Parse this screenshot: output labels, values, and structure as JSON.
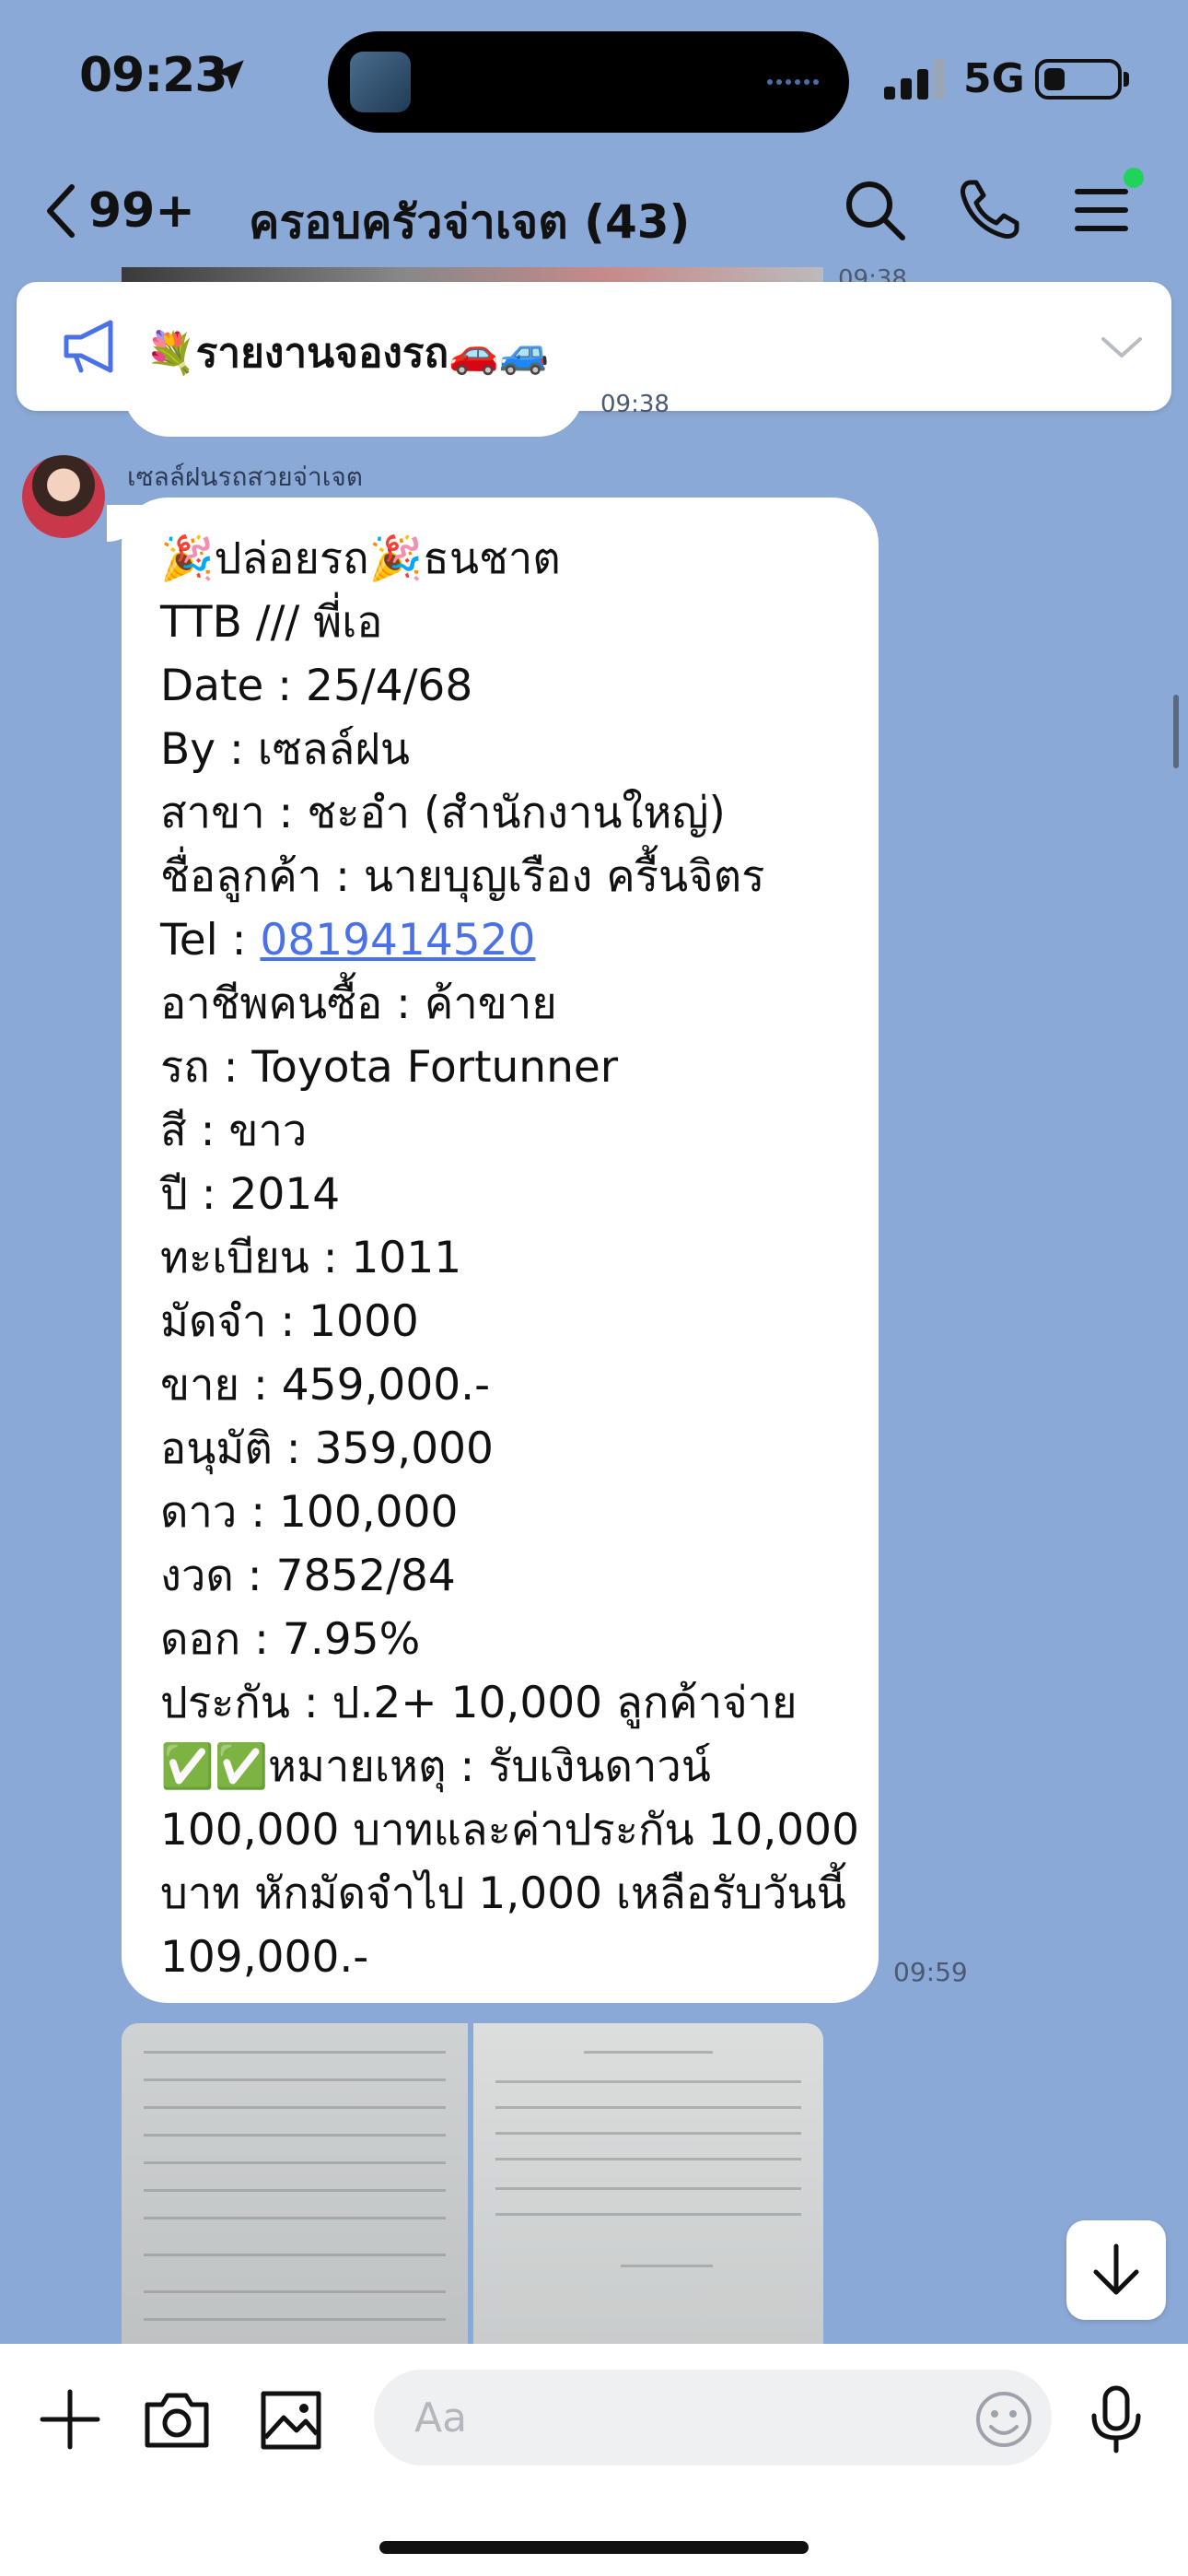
{
  "status_bar": {
    "time": "09:23",
    "network": "5G"
  },
  "header": {
    "unread_count": "99+",
    "chat_title": "ครอบครัวจ่าเจต (43)"
  },
  "announcement": {
    "text": "💐รายงานจองรถ🚗🚙"
  },
  "previous": {
    "time_top": "09:38",
    "time": "09:38"
  },
  "message": {
    "sender_name": "เซลล์ฝนรถสวยจ่าเจต",
    "text_before_phone": "🎉ปล่อยรถ🎉ธนชาต\nTTB /// พี่เอ\nDate : 25/4/68\nBy : เซลล์ฝน\nสาขา : ชะอำ (สำนักงานใหญ่)\nชื่อลูกค้า : นายบุญเรือง ครื้นจิตร\nTel : ",
    "phone": "0819414520",
    "text_after_phone": "\nอาชีพคนซื้อ : ค้าขาย\nรถ : Toyota Fortunner\nสี : ขาว\nปี : 2014\nทะเบียน : 1011\nมัดจำ : 1000\nขาย : 459,000.-\nอนุมัติ : 359,000\nดาว : 100,000\nงวด : 7852/84\nดอก : 7.95%\nประกัน :  ป.2+ 10,000 ลูกค้าจ่าย\n✅✅หมายเหตุ : รับเงินดาวน์ 100,000 บาทและค่าประกัน 10,000 บาท หักมัดจำไป 1,000 เหลือรับวันนี้ 109,000.-",
    "time": "09:59"
  },
  "input": {
    "placeholder": "Aa"
  },
  "colors": {
    "background": "#8ba9d6",
    "link": "#4a72e6",
    "online_dot": "#1fd35c"
  },
  "icons": {
    "back": "chevron-left-icon",
    "search": "search-icon",
    "call": "phone-icon",
    "menu": "menu-icon",
    "announcement": "megaphone-icon",
    "expand": "chevron-down-icon",
    "add": "plus-icon",
    "camera": "camera-icon",
    "gallery": "image-icon",
    "emoji": "emoji-icon",
    "voice": "microphone-icon",
    "scroll": "arrow-down-icon"
  }
}
